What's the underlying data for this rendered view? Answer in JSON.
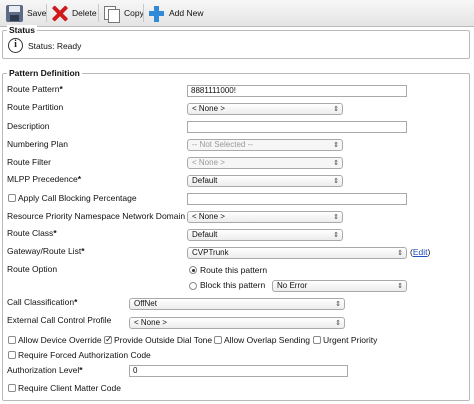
{
  "toolbar": {
    "save_label": "Save",
    "delete_label": "Delete",
    "copy_label": "Copy",
    "add_new_label": "Add New"
  },
  "status": {
    "legend": "Status",
    "text": "Status: Ready"
  },
  "pattern": {
    "legend": "Pattern Definition",
    "route_pattern": {
      "label": "Route Pattern",
      "required": "*",
      "value": "8881111000!"
    },
    "route_partition": {
      "label": "Route Partition",
      "value": "< None >"
    },
    "description": {
      "label": "Description",
      "value": ""
    },
    "numbering_plan": {
      "label": "Numbering Plan",
      "value": "-- Not Selected --"
    },
    "route_filter": {
      "label": "Route Filter",
      "value": "< None >"
    },
    "mlpp_precedence": {
      "label": "MLPP Precedence",
      "required": "*",
      "value": "Default"
    },
    "apply_call_blocking": {
      "label": "Apply Call Blocking Percentage",
      "checked": false,
      "value": ""
    },
    "resource_priority": {
      "label": "Resource Priority Namespace Network Domain",
      "value": "< None >"
    },
    "route_class": {
      "label": "Route Class",
      "required": "*",
      "value": "Default"
    },
    "gateway_route_list": {
      "label": "Gateway/Route List",
      "required": "*",
      "value": "CVPTrunk",
      "edit_open": "(",
      "edit_link": "Edit",
      "edit_close": ")"
    },
    "route_option": {
      "label": "Route Option",
      "route_this_pattern": "Route this pattern",
      "block_this_pattern": "Block this pattern",
      "block_reason": "No Error"
    },
    "call_classification": {
      "label": "Call Classification",
      "required": "*",
      "value": "OffNet"
    },
    "external_call_control": {
      "label": "External Call Control Profile",
      "value": "< None >"
    },
    "checkboxes": {
      "allow_device_override": "Allow Device Override",
      "provide_outside_dial_tone": "Provide Outside Dial Tone",
      "allow_overlap_sending": "Allow Overlap Sending",
      "urgent_priority": "Urgent Priority"
    },
    "require_forced_auth": "Require Forced Authorization Code",
    "authorization_level": {
      "label": "Authorization Level",
      "required": "*",
      "value": "0"
    },
    "require_client_matter": "Require Client Matter Code"
  }
}
